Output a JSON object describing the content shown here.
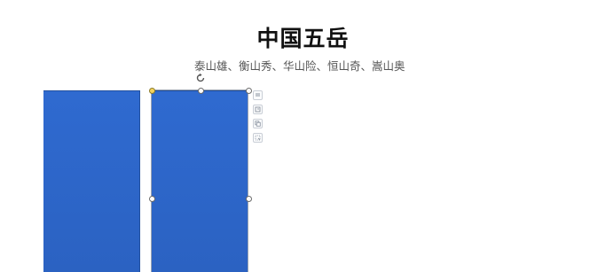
{
  "slide": {
    "title": "中国五岳",
    "subtitle": "泰山雄、衡山秀、华山险、恒山奇、嵩山奥"
  },
  "icons": {
    "rotate": "rotate-icon",
    "toolbar": [
      "layout-options-icon",
      "align-icon",
      "copy-style-icon",
      "crop-icon"
    ]
  },
  "colors": {
    "block_fill": "#2d66c7",
    "selection_border": "#9aa4b3",
    "adjust_handle": "#f4d35e"
  }
}
